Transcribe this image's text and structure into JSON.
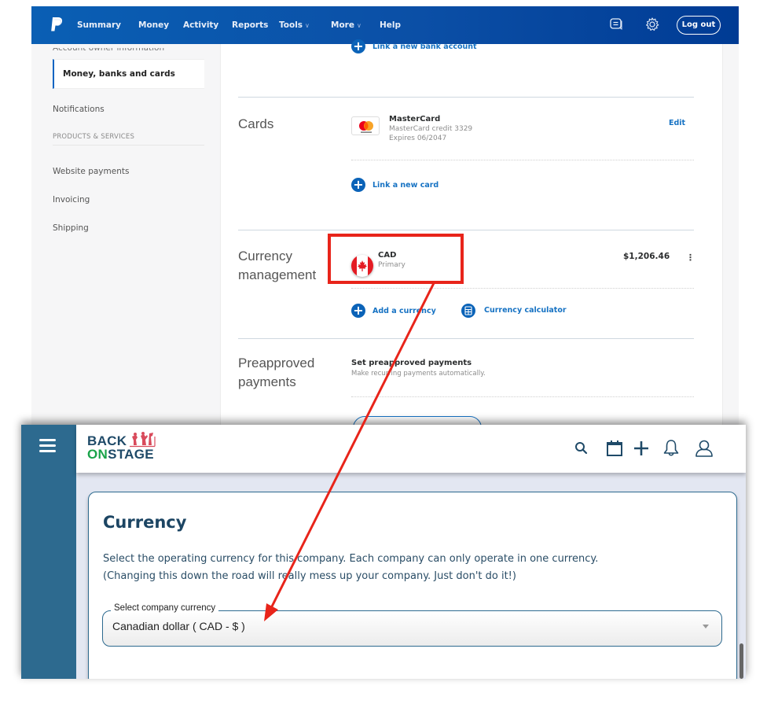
{
  "paypal": {
    "nav": {
      "items": [
        "Summary",
        "Money",
        "Activity",
        "Reports",
        "Tools",
        "More",
        "Help"
      ],
      "dropdown_indicator": "∨",
      "logout_label": "Log out",
      "icons": [
        "paypal-logo",
        "message-center-icon",
        "settings-gear-icon"
      ]
    },
    "sidebar": {
      "cut_item": "Account owner information",
      "active_item": "Money, banks and cards",
      "items_top": [
        "Notifications"
      ],
      "section_label": "PRODUCTS & SERVICES",
      "items_products": [
        "Website payments",
        "Invoicing",
        "Shipping"
      ]
    },
    "main": {
      "link_bank": "Link a new bank account",
      "cards": {
        "title": "Cards",
        "card_name": "MasterCard",
        "card_detail": "MasterCard credit  3329",
        "card_expiry": "Expires 06/2047",
        "edit_label": "Edit",
        "link_card": "Link a new card"
      },
      "currency": {
        "title_line1": "Currency",
        "title_line2": "management",
        "code": "CAD",
        "status": "Primary",
        "balance": "$1,206.46",
        "more_icon": "⋮",
        "add_currency": "Add a currency",
        "calculator": "Currency calculator"
      },
      "preapproved": {
        "title_line1": "Preapproved",
        "title_line2": "payments",
        "heading": "Set preapproved payments",
        "description": "Make recurring payments automatically."
      }
    }
  },
  "backonstage": {
    "logo_line1": "BACK",
    "logo_on": "ON",
    "logo_stage": "STAGE",
    "header_icons": [
      "search-icon",
      "calendar-icon",
      "plus-icon",
      "bell-icon",
      "user-icon"
    ],
    "card": {
      "title": "Currency",
      "description_line1": "Select the operating currency for this company. Each company can only operate in one currency.",
      "description_line2": "(Changing this down the road will really mess up your company. Just don't do it!)",
      "select_label": "Select company currency",
      "select_value": "Canadian dollar ( CAD - $ )"
    }
  },
  "annotation": {
    "color": "#e8241a",
    "highlight": "CAD Primary",
    "arrow_target": "Select company currency"
  },
  "colors": {
    "paypal_nav": "#0b4fa6",
    "paypal_link": "#1672c3",
    "bos_rail": "#2d6a8f",
    "bos_title": "#1c4563",
    "bos_green": "#1aa34a"
  }
}
